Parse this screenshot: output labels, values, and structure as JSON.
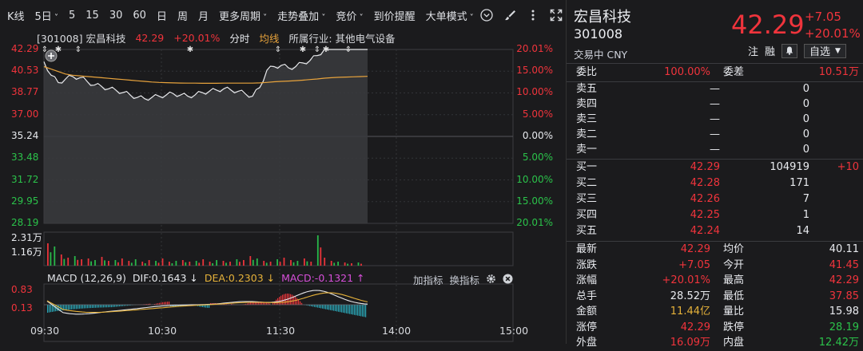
{
  "toolbar": {
    "items": [
      "K线",
      "5日",
      "5",
      "15",
      "30",
      "60",
      "日",
      "周",
      "月",
      "更多周期",
      "走势叠加",
      "竞价",
      "到价提醒",
      "大单模式"
    ],
    "dropdown_indices": [
      1,
      9,
      10,
      11,
      13
    ]
  },
  "chart": {
    "code_name": "[301008] 宏昌科技",
    "price": "42.29",
    "pct": "+20.01%",
    "mode1": "分时",
    "mode2": "均线",
    "industry": "所属行业: 其他电气设备",
    "y_left": [
      "42.29",
      "40.53",
      "38.77",
      "37.00",
      "35.24",
      "33.48",
      "31.72",
      "29.95",
      "28.19"
    ],
    "y_right": [
      "20.01%",
      "15.00%",
      "10.00%",
      "5.00%",
      "0.00%",
      "5.00%",
      "10.00%",
      "15.00%",
      "20.01%"
    ],
    "vol_labels": [
      "2.31万",
      "1.16万"
    ],
    "macd_labels": [
      "0.83",
      "0.13"
    ],
    "macd_title": "MACD (12,26,9)",
    "dif": "DIF:0.1643",
    "dea": "DEA:0.2303",
    "macd": "MACD:-0.1321",
    "tool_add": "加指标",
    "tool_switch": "换指标",
    "x_labels": [
      "09:30",
      "10:30",
      "11:30",
      "14:00",
      "15:00"
    ]
  },
  "chart_data": {
    "type": "line",
    "x_range": [
      "09:30",
      "15:00"
    ],
    "ylim": [
      28.19,
      42.29
    ],
    "prev_close": 35.24,
    "price_series": [
      41.3,
      40.2,
      39.6,
      39.9,
      40.1,
      40.0,
      39.7,
      39.4,
      39.3,
      39.1,
      39.0,
      38.8,
      38.6,
      38.4,
      38.3,
      38.4,
      38.5,
      38.6,
      38.7,
      38.6,
      38.5,
      38.6,
      38.8,
      38.9,
      39.0,
      39.1,
      39.0,
      38.9,
      38.7,
      38.5,
      39.2,
      40.6,
      40.9,
      41.0,
      40.8,
      40.9,
      41.2,
      41.4,
      41.8,
      42.29,
      42.29,
      42.29,
      42.29,
      42.29,
      42.29,
      42.29
    ],
    "avg_series": [
      40.9,
      40.7,
      40.5,
      40.3,
      40.2,
      40.15,
      40.1,
      40.05,
      40.0,
      39.95,
      39.9,
      39.85,
      39.8,
      39.75,
      39.7,
      39.65,
      39.62,
      39.6,
      39.58,
      39.57,
      39.56,
      39.56,
      39.55,
      39.55,
      39.55,
      39.56,
      39.56,
      39.56,
      39.56,
      39.56,
      39.58,
      39.62,
      39.67,
      39.7,
      39.73,
      39.76,
      39.8,
      39.85,
      39.9,
      39.96,
      40.0,
      40.03,
      40.05,
      40.07,
      40.09,
      40.11
    ]
  },
  "quote": {
    "name": "宏昌科技",
    "code": "301008",
    "status": "交易中 CNY",
    "price": "42.29",
    "change": "+7.05",
    "change_pct": "+20.01%",
    "tag1": "注",
    "tag2": "融",
    "watch": "自选",
    "weibi_label": "委比",
    "weibi": "100.00%",
    "weicha_label": "委差",
    "weicha": "10.51万",
    "sells": [
      {
        "l": "卖五",
        "p": "—",
        "v": "0"
      },
      {
        "l": "卖四",
        "p": "—",
        "v": "0"
      },
      {
        "l": "卖三",
        "p": "—",
        "v": "0"
      },
      {
        "l": "卖二",
        "p": "—",
        "v": "0"
      },
      {
        "l": "卖一",
        "p": "—",
        "v": "0"
      }
    ],
    "buys": [
      {
        "l": "买一",
        "p": "42.29",
        "v": "104919",
        "d": "+10"
      },
      {
        "l": "买二",
        "p": "42.28",
        "v": "171",
        "d": ""
      },
      {
        "l": "买三",
        "p": "42.26",
        "v": "7",
        "d": ""
      },
      {
        "l": "买四",
        "p": "42.25",
        "v": "1",
        "d": ""
      },
      {
        "l": "买五",
        "p": "42.24",
        "v": "14",
        "d": ""
      }
    ],
    "stats": [
      {
        "l1": "最新",
        "v1": "42.29",
        "c1": "red",
        "l2": "均价",
        "v2": "40.11",
        "c2": "white"
      },
      {
        "l1": "涨跌",
        "v1": "+7.05",
        "c1": "red",
        "l2": "今开",
        "v2": "41.45",
        "c2": "red"
      },
      {
        "l1": "涨幅",
        "v1": "+20.01%",
        "c1": "red",
        "l2": "最高",
        "v2": "42.29",
        "c2": "red"
      },
      {
        "l1": "总手",
        "v1": "28.52万",
        "c1": "white",
        "l2": "最低",
        "v2": "37.85",
        "c2": "red"
      },
      {
        "l1": "金额",
        "v1": "11.44亿",
        "c1": "yellow",
        "l2": "量比",
        "v2": "15.98",
        "c2": "white"
      },
      {
        "l1": "涨停",
        "v1": "42.29",
        "c1": "red",
        "l2": "跌停",
        "v2": "28.19",
        "c2": "green"
      },
      {
        "l1": "外盘",
        "v1": "16.09万",
        "c1": "red",
        "l2": "内盘",
        "v2": "12.42万",
        "c2": "green"
      }
    ]
  }
}
